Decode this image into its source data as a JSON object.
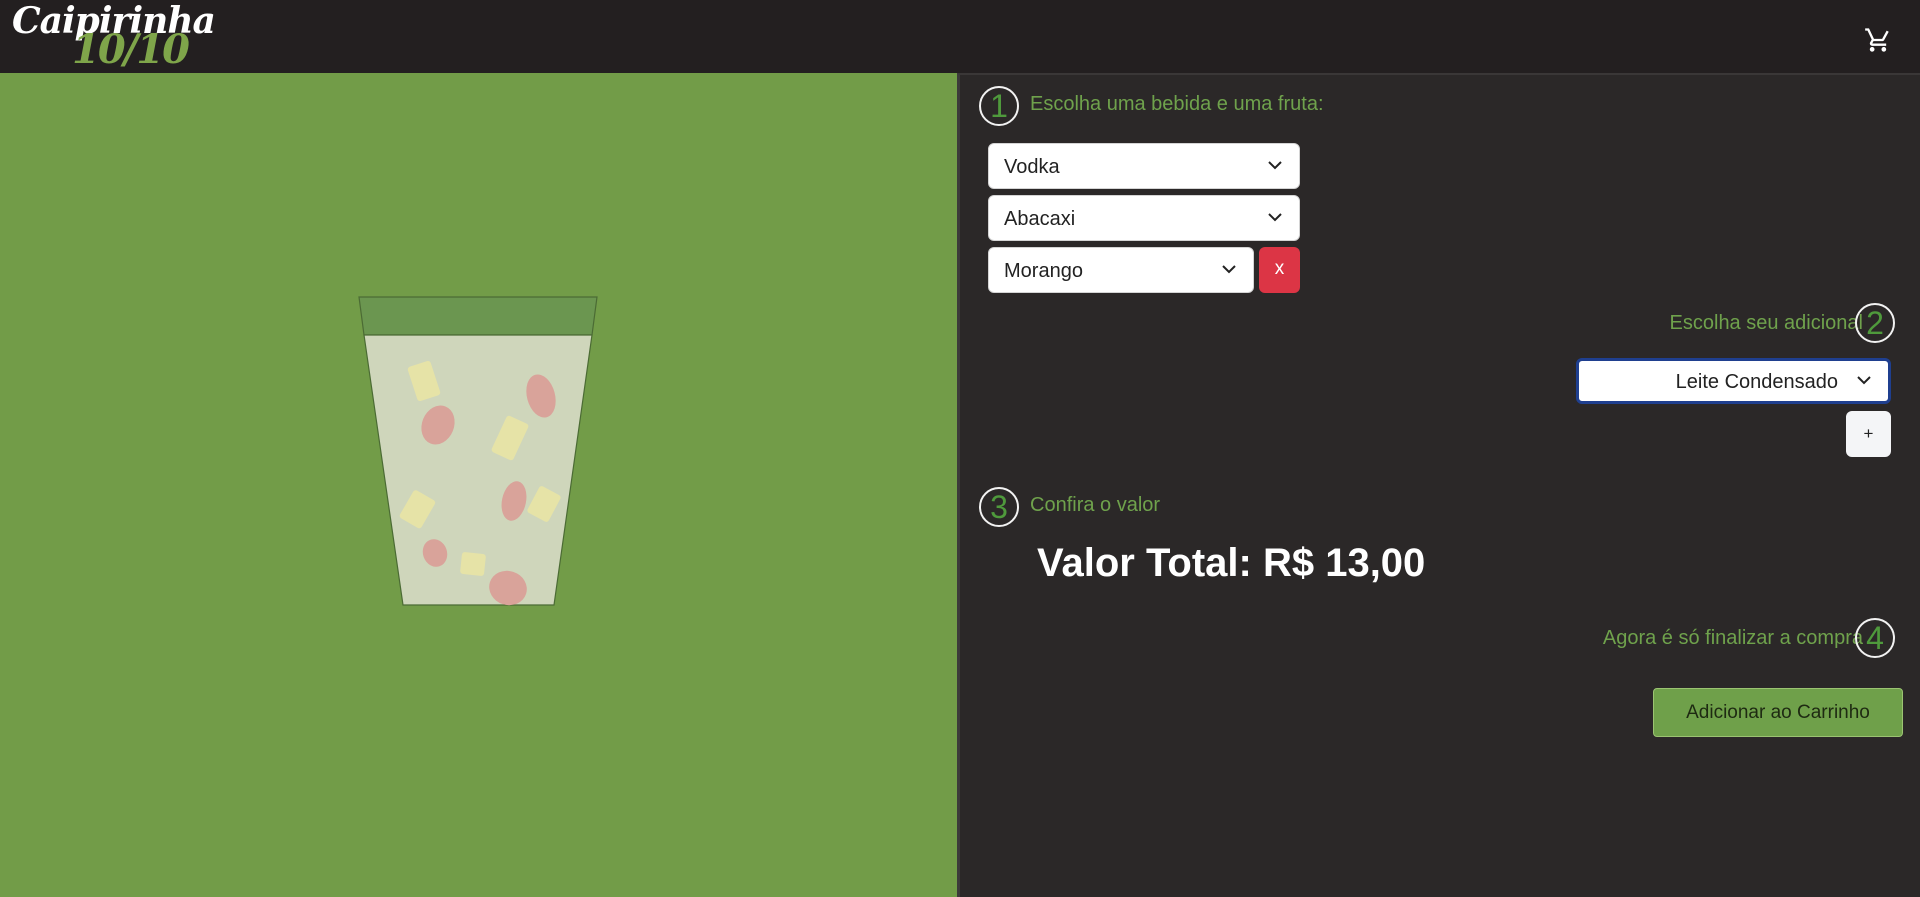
{
  "brand": {
    "script": "Caipirinha",
    "score": "10/10"
  },
  "header": {
    "cart_icon": "shopping-cart-icon"
  },
  "step1": {
    "number": "1",
    "label": "Escolha uma bebida e uma fruta:",
    "drink": "Vodka",
    "fruit1": "Abacaxi",
    "fruit2": "Morango",
    "remove_label": "x"
  },
  "step2": {
    "number": "2",
    "label": "Escolha seu adicional",
    "addon": "Leite Condensado",
    "add_label": "+"
  },
  "step3": {
    "number": "3",
    "label": "Confira o valor",
    "total": "Valor Total: R$ 13,00"
  },
  "step4": {
    "number": "4",
    "label": "Agora é só finalizar a compra",
    "cta": "Adicionar ao Carrinho"
  },
  "colors": {
    "accent_green": "#729c48",
    "panel_dark": "#2b2828",
    "danger": "#dc3545"
  }
}
